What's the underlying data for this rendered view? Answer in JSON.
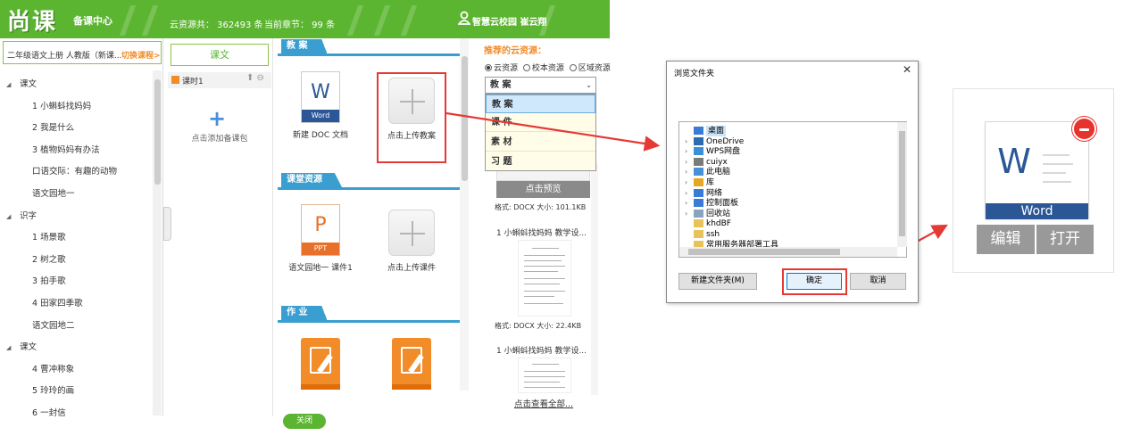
{
  "header": {
    "logo": "尚课",
    "subtitle": "备课中心",
    "resource_total": "云资源共： 362493  条",
    "current_chapter": "当前章节： 99  条",
    "user": "智慧云校园  崔云翔"
  },
  "sidebar": {
    "course_name": "二年级语文上册 人教版（新课...",
    "switch_label": "切换课程>",
    "items": [
      {
        "label": "课文",
        "level": "group"
      },
      {
        "label": "1 小蝌蚪找妈妈",
        "level": "child"
      },
      {
        "label": "2 我是什么",
        "level": "child"
      },
      {
        "label": "3 植物妈妈有办法",
        "level": "child"
      },
      {
        "label": "口语交际：有趣的动物",
        "level": "child"
      },
      {
        "label": "语文园地一",
        "level": "child"
      },
      {
        "label": "识字",
        "level": "group"
      },
      {
        "label": "1 场景歌",
        "level": "child"
      },
      {
        "label": "2 树之歌",
        "level": "child"
      },
      {
        "label": "3 拍手歌",
        "level": "child"
      },
      {
        "label": "4 田家四季歌",
        "level": "child"
      },
      {
        "label": "语文园地二",
        "level": "child"
      },
      {
        "label": "课文",
        "level": "group"
      },
      {
        "label": "4 曹冲称象",
        "level": "child"
      },
      {
        "label": "5 玲玲的画",
        "level": "child"
      },
      {
        "label": "6 一封信",
        "level": "child"
      }
    ]
  },
  "lessons": {
    "tab": "课文",
    "item": "课时1",
    "actions": "⬆ ⊖",
    "add_label": "点击添加备课包"
  },
  "sections": {
    "plan": {
      "title": "教 案",
      "file_type": "Word",
      "file_name": "新建 DOC 文档",
      "upload_label": "点击上传教案"
    },
    "class": {
      "title": "课堂资源",
      "file_type": "PPT",
      "file_name": "语文园地一 课件1",
      "upload_label": "点击上传课件"
    },
    "homework": {
      "title": "作 业"
    }
  },
  "recommend": {
    "title": "推荐的云资源：",
    "radios": [
      "云资源",
      "校本资源",
      "区域资源"
    ],
    "select_value": "教 案",
    "options": [
      "教 案",
      "课 件",
      "素 材",
      "习 题"
    ],
    "preview_label": "点击预览",
    "items": [
      {
        "meta": "格式: DOCX  大小: 101.1KB"
      },
      {
        "title": "1 小蝌蚪找妈妈 教学设...",
        "meta": "格式: DOCX  大小: 22.4KB"
      },
      {
        "title": "1 小蝌蚪找妈妈 教学设..."
      }
    ],
    "view_all": "点击查看全部..."
  },
  "close_label": "关闭",
  "dialog": {
    "title": "浏览文件夹",
    "close": "✕",
    "tree": [
      {
        "label": "桌面",
        "color": "#3a7bd5"
      },
      {
        "label": "OneDrive",
        "color": "#2b6cb0"
      },
      {
        "label": "WPS网盘",
        "color": "#3a8fd8"
      },
      {
        "label": "cuiyx",
        "color": "#7a7a7a"
      },
      {
        "label": "此电脑",
        "color": "#4a90d9"
      },
      {
        "label": "库",
        "color": "#e5a823"
      },
      {
        "label": "网络",
        "color": "#3a7bd5"
      },
      {
        "label": "控制面板",
        "color": "#3a7bd5"
      },
      {
        "label": "回收站",
        "color": "#8aa4c0"
      },
      {
        "label": "khdBF",
        "color": "#e8c25a"
      },
      {
        "label": "ssh",
        "color": "#e8c25a"
      },
      {
        "label": "常用服务器部署工具",
        "color": "#e8c25a"
      }
    ],
    "new_folder": "新建文件夹(M)",
    "ok": "确定",
    "cancel": "取消"
  },
  "word_card": {
    "letter": "W",
    "type": "Word",
    "edit": "编辑",
    "open": "打开"
  },
  "colors": {
    "brand": "#5cb531",
    "section_blue": "#3a9fd0",
    "word_blue": "#2b5797",
    "accent_orange": "#f28c28",
    "highlight_red": "#e53935"
  }
}
